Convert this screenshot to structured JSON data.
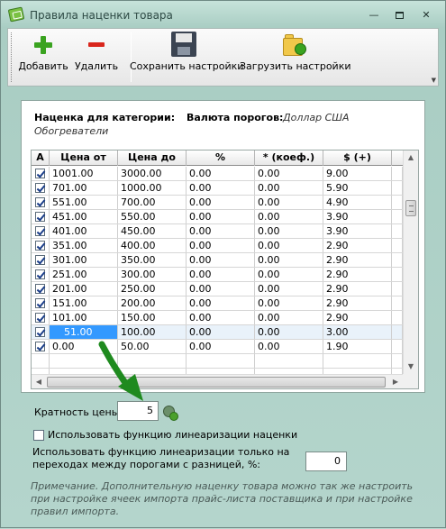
{
  "window": {
    "title": "Правила наценки товара",
    "min_glyph": "—",
    "close_glyph": "✕"
  },
  "toolbar": {
    "add_label": "Добавить",
    "delete_label": "Удалить",
    "save_label": "Сохранить настройки",
    "load_label": "Загрузить настройки",
    "more_glyph": "▼"
  },
  "category": {
    "label": "Наценка для категории:",
    "value": "Обогреватели"
  },
  "currency": {
    "label": "Валюта порогов:",
    "value": "Доллар США"
  },
  "grid": {
    "columns": [
      "А",
      "Цена от",
      "Цена до",
      "%",
      "* (коеф.)",
      "$ (+)"
    ],
    "rows": [
      {
        "active": true,
        "from": "1001.00",
        "to": "3000.00",
        "pct": "0.00",
        "coef": "0.00",
        "plus": "9.00"
      },
      {
        "active": true,
        "from": "701.00",
        "to": "1000.00",
        "pct": "0.00",
        "coef": "0.00",
        "plus": "5.90"
      },
      {
        "active": true,
        "from": "551.00",
        "to": "700.00",
        "pct": "0.00",
        "coef": "0.00",
        "plus": "4.90"
      },
      {
        "active": true,
        "from": "451.00",
        "to": "550.00",
        "pct": "0.00",
        "coef": "0.00",
        "plus": "3.90"
      },
      {
        "active": true,
        "from": "401.00",
        "to": "450.00",
        "pct": "0.00",
        "coef": "0.00",
        "plus": "3.90"
      },
      {
        "active": true,
        "from": "351.00",
        "to": "400.00",
        "pct": "0.00",
        "coef": "0.00",
        "plus": "2.90"
      },
      {
        "active": true,
        "from": "301.00",
        "to": "350.00",
        "pct": "0.00",
        "coef": "0.00",
        "plus": "2.90"
      },
      {
        "active": true,
        "from": "251.00",
        "to": "300.00",
        "pct": "0.00",
        "coef": "0.00",
        "plus": "2.90"
      },
      {
        "active": true,
        "from": "201.00",
        "to": "250.00",
        "pct": "0.00",
        "coef": "0.00",
        "plus": "2.90"
      },
      {
        "active": true,
        "from": "151.00",
        "to": "200.00",
        "pct": "0.00",
        "coef": "0.00",
        "plus": "2.90"
      },
      {
        "active": true,
        "from": "101.00",
        "to": "150.00",
        "pct": "0.00",
        "coef": "0.00",
        "plus": "2.90"
      },
      {
        "active": true,
        "from": "51.00",
        "to": "100.00",
        "pct": "0.00",
        "coef": "0.00",
        "plus": "3.00"
      },
      {
        "active": true,
        "from": "0.00",
        "to": "50.00",
        "pct": "0.00",
        "coef": "0.00",
        "plus": "1.90"
      }
    ]
  },
  "multiplicity": {
    "label": "Кратность цены:",
    "value": "5"
  },
  "linearization": {
    "checked": false,
    "label": "Использовать функцию линеаризации наценки",
    "diff_label": "Использовать функцию линеаризации только на переходах между порогами с разницей, %:",
    "diff_value": "0"
  },
  "note": "Примечание. Дополнительную наценку товара можно так же настроить при настройке ячеек импорта прайс-листа поставщика и при настройке правил импорта.",
  "colors": {
    "selection": "#3399ff",
    "arrow": "#1f8a1f"
  }
}
